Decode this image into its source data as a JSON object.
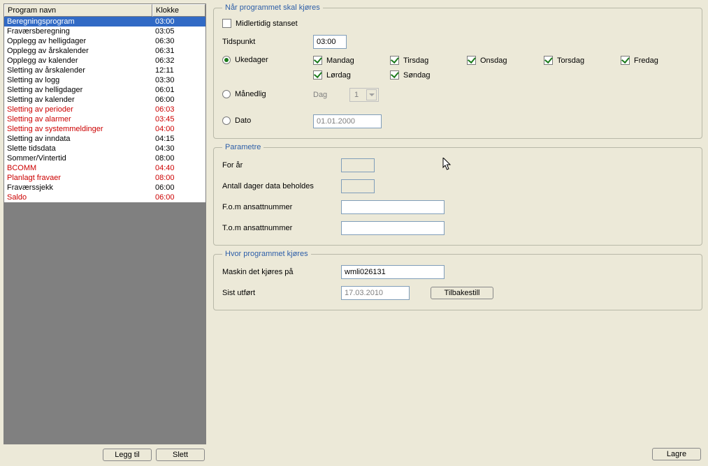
{
  "table": {
    "headers": {
      "program": "Program navn",
      "time": "Klokke"
    },
    "rows": [
      {
        "name": "Beregningsprogram",
        "time": "03:00",
        "red": false,
        "selected": true
      },
      {
        "name": "Fraværsberegning",
        "time": "03:05",
        "red": false
      },
      {
        "name": "Opplegg av helligdager",
        "time": "06:30",
        "red": false
      },
      {
        "name": "Opplegg av årskalender",
        "time": "06:31",
        "red": false
      },
      {
        "name": "Opplegg av kalender",
        "time": "06:32",
        "red": false
      },
      {
        "name": "Sletting av årskalender",
        "time": "12:11",
        "red": false
      },
      {
        "name": "Sletting av logg",
        "time": "03:30",
        "red": false
      },
      {
        "name": "Sletting av helligdager",
        "time": "06:01",
        "red": false
      },
      {
        "name": "Sletting av kalender",
        "time": "06:00",
        "red": false
      },
      {
        "name": "Sletting av perioder",
        "time": "06:03",
        "red": true
      },
      {
        "name": "Sletting av alarmer",
        "time": "03:45",
        "red": true
      },
      {
        "name": "Sletting av systemmeldinger",
        "time": "04:00",
        "red": true
      },
      {
        "name": "Sletting av inndata",
        "time": "04:15",
        "red": false
      },
      {
        "name": "Slette tidsdata",
        "time": "04:30",
        "red": false
      },
      {
        "name": "Sommer/Vintertid",
        "time": "08:00",
        "red": false
      },
      {
        "name": "BCOMM",
        "time": "04:40",
        "red": true
      },
      {
        "name": "Planlagt fravaer",
        "time": "08:00",
        "red": true
      },
      {
        "name": "Fraværssjekk",
        "time": "06:00",
        "red": false
      },
      {
        "name": "Saldo",
        "time": "06:00",
        "red": true
      }
    ]
  },
  "buttons": {
    "add": "Legg til",
    "delete": "Slett",
    "reset": "Tilbakestill",
    "save": "Lagre"
  },
  "schedule": {
    "legend": "Når programmet skal kjøres",
    "paused": "Midlertidig stanset",
    "time_label": "Tidspunkt",
    "time_value": "03:00",
    "weekdays_label": "Ukedager",
    "monthly_label": "Månedlig",
    "monthly_day_label": "Dag",
    "monthly_day_value": "1",
    "date_label": "Dato",
    "date_value": "01.01.2000",
    "days": {
      "mon": "Mandag",
      "tue": "Tirsdag",
      "wed": "Onsdag",
      "thu": "Torsdag",
      "fri": "Fredag",
      "sat": "Lørdag",
      "sun": "Søndag"
    }
  },
  "params": {
    "legend": "Parametre",
    "for_year": "For år",
    "keep_days": "Antall dager data beholdes",
    "emp_from": "F.o.m ansattnummer",
    "emp_to": "T.o.m ansattnummer"
  },
  "run": {
    "legend": "Hvor programmet kjøres",
    "machine_label": "Maskin det kjøres på",
    "machine_value": "wmli026131",
    "last_run_label": "Sist utført",
    "last_run_value": "17.03.2010"
  }
}
